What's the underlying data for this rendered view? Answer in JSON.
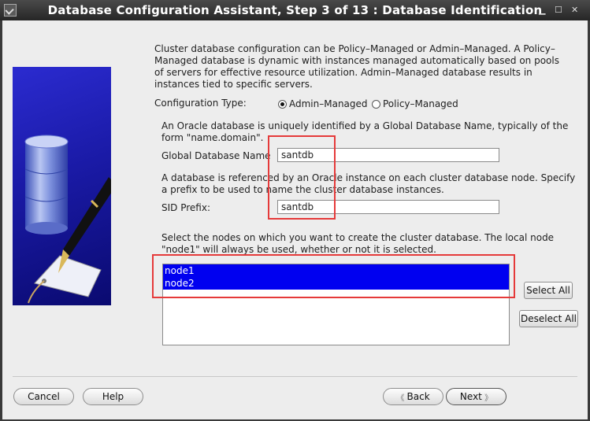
{
  "window": {
    "title": "Database Configuration Assistant, Step 3 of 13 : Database Identification"
  },
  "intro_text": "Cluster database configuration can be Policy–Managed or Admin–Managed. A Policy–Managed database is dynamic with instances managed automatically based on pools of servers for effective resource utilization. Admin–Managed database results in instances tied to specific servers.",
  "config_type": {
    "label": "Configuration Type:",
    "options": [
      "Admin–Managed",
      "Policy–Managed"
    ],
    "selected": "Admin–Managed"
  },
  "gdn_text": "An Oracle database is uniquely identified by a Global Database Name, typically of the form \"name.domain\".",
  "global_db_name": {
    "label": "Global Database Name",
    "value": "santdb"
  },
  "sid_text": "A database is referenced by an Oracle instance on each cluster database node. Specify a prefix to be used to name the cluster database instances.",
  "sid_prefix": {
    "label": "SID Prefix:",
    "value": "santdb"
  },
  "nodes_text": "Select the nodes on which you want to create the cluster database. The local node \"node1\" will always be used, whether or not it is selected.",
  "nodes": [
    "node1",
    "node2"
  ],
  "buttons": {
    "select_all": "Select All",
    "deselect_all": "Deselect All",
    "cancel": "Cancel",
    "help": "Help",
    "back": "Back",
    "next": "Next"
  },
  "colors": {
    "highlight_box": "#e53a3a",
    "selection": "#0000f0",
    "titlebar": "#262626"
  }
}
